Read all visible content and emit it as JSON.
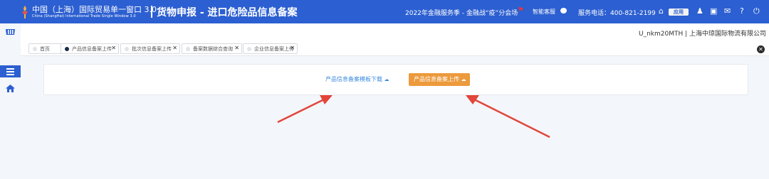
{
  "header": {
    "brand_cn": "中国（上海）国际贸易单一窗口 3.0",
    "brand_en": "China (ShangHai) International Trade Single Window 3.0",
    "page_title": "货物申报 - 进口危险品信息备案",
    "promo": "2022年金融服务季 - 金融战“疫”分会场",
    "assistant": "智能客服",
    "phone": "服务电话：400-821-2199",
    "badge": "应用",
    "icons": [
      "home-icon",
      "apps-icon",
      "user-icon",
      "shirt-icon",
      "message-icon",
      "help-icon",
      "power-icon"
    ]
  },
  "user": {
    "label": "U_nkm20MTH | 上海中琼国际物流有限公司"
  },
  "tabs": [
    {
      "label": "首页",
      "closable": false,
      "active": false
    },
    {
      "label": "产品信息备案上传",
      "closable": true,
      "active": true
    },
    {
      "label": "批次信息备案上传",
      "closable": true,
      "active": false
    },
    {
      "label": "备案数据综合查询",
      "closable": true,
      "active": false
    },
    {
      "label": "企业信息备案上传",
      "closable": true,
      "active": false
    }
  ],
  "main": {
    "download_link": "产品信息备案模板下载",
    "upload_button": "产品信息备案上传"
  },
  "colors": {
    "primary": "#2c5fd1",
    "upload": "#ec9a3c",
    "link": "#3d8be0",
    "arrow": "#e2453a"
  }
}
